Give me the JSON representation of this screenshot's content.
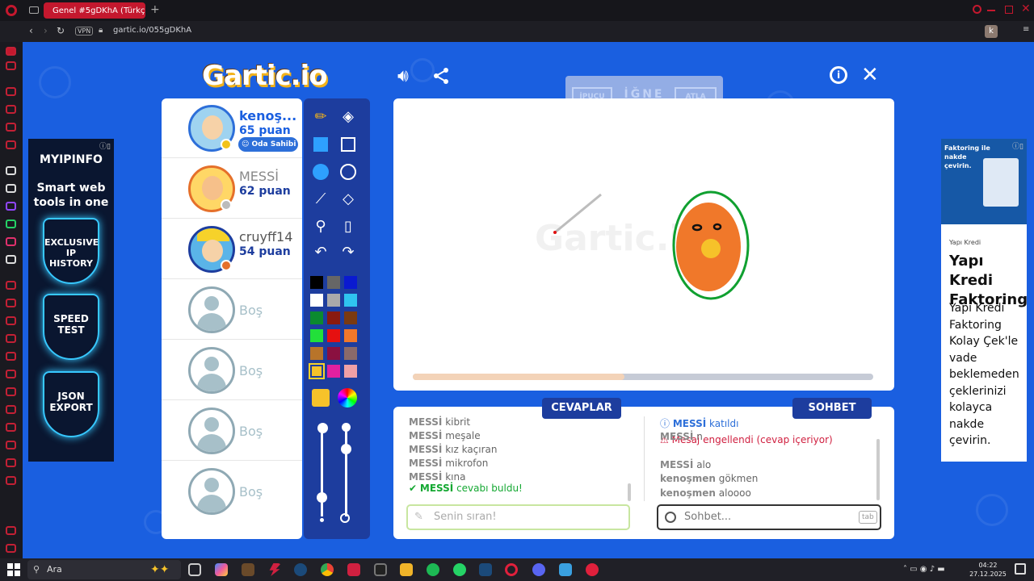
{
  "browser": {
    "tab_title": "Genel #5gDKhA (Türkçe)",
    "vpn_label": "VPN",
    "url": "gartic.io/055gDKhA",
    "profile_letter": "k"
  },
  "game": {
    "logo_text": "Gartic.io",
    "word_hint": "İĞNE",
    "skip_left": "İPUCU",
    "skip_right": "ATLA",
    "progress_fraction": 0.46,
    "players": [
      {
        "name": "kenoş...",
        "points": "65 puan",
        "badge": "Oda Sahibi",
        "status": "drawing"
      },
      {
        "name": "MESSİ",
        "points": "62 puan",
        "status": "guessed"
      },
      {
        "name": "cruyff14",
        "points": "54 puan",
        "status": ""
      }
    ],
    "empty_slot_label": "Boş",
    "empty_slots": 4,
    "palette": [
      "#000000",
      "#666666",
      "#0a1ad0",
      "#ffffff",
      "#aaaaaa",
      "#2fc4f0",
      "#0b8a2f",
      "#8a1a10",
      "#7a3a12",
      "#22e03a",
      "#e61010",
      "#f0782a",
      "#b8742a",
      "#8a1040",
      "#8a6a6a",
      "#f6c22a",
      "#e020a0",
      "#f0a0a6"
    ],
    "selected_color": "#f6c22a"
  },
  "answers": {
    "header": "CEVAPLAR",
    "messages": [
      {
        "user": "MESSİ",
        "text": "kibrit"
      },
      {
        "user": "MESSİ",
        "text": "meşale"
      },
      {
        "user": "MESSİ",
        "text": "kız kaçıran"
      },
      {
        "user": "MESSİ",
        "text": "mikrofon"
      },
      {
        "user": "MESSİ",
        "text": "kına"
      }
    ],
    "found_user": "MESSİ",
    "found_text": "cevabı buldu!",
    "input_placeholder": "Senin sıran!"
  },
  "chat": {
    "header": "SOHBET",
    "joined_user": "MESSİ",
    "joined_text": "katıldı",
    "blocked_text": "Mesaj engellendi (cevap içeriyor)",
    "messages": [
      {
        "user": "MESSİ",
        "text": "n"
      },
      {
        "user": "MESSİ",
        "text": "alo"
      },
      {
        "user": "kenoşmen",
        "text": "gökmen"
      },
      {
        "user": "kenoşmen",
        "text": "aloooo"
      }
    ],
    "input_placeholder": "Sohbet...",
    "tab_hint": "tab"
  },
  "ad_left": {
    "brand": "MYIPINFO",
    "tagline": "Smart web tools in one",
    "badges": [
      "EXCLUSIVE IP HISTORY",
      "SPEED TEST",
      "JSON EXPORT"
    ]
  },
  "ad_right": {
    "image_caption": "Faktoring ile nakde çevirin.",
    "small_label": "Yapı Kredi",
    "title": "Yapı Kredi Faktoring",
    "body": "Yapı Kredi Faktoring Kolay Çek'le vade beklemeden çeklerinizi kolayca nakde çevirin."
  },
  "taskbar": {
    "search_label": "Ara",
    "time": "04:22",
    "date": "27.12.2025"
  },
  "colors": {
    "game_bg": "#1a5fe0",
    "panel_dark": "#1d3d9e",
    "accent_red": "#c4182e",
    "text_blue": "#1a5fe0"
  }
}
